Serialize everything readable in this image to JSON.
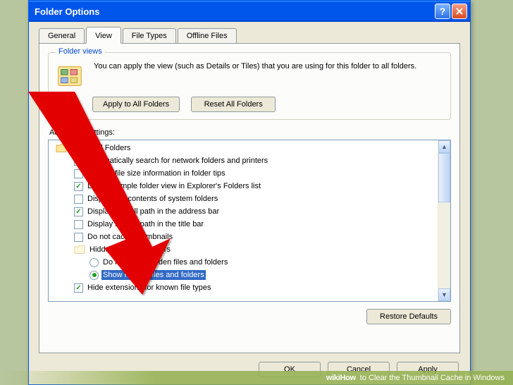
{
  "titlebar": {
    "title": "Folder Options"
  },
  "tabs": {
    "general": "General",
    "view": "View",
    "file_types": "File Types",
    "offline_files": "Offline Files"
  },
  "folder_views": {
    "legend": "Folder views",
    "text": "You can apply the view (such as Details or Tiles) that you are using for this folder to all folders.",
    "apply_all": "Apply to All Folders",
    "reset_all": "Reset All Folders"
  },
  "advanced": {
    "label": "Advanced settings:",
    "root": "Files and Folders",
    "items": [
      {
        "kind": "checkbox",
        "checked": true,
        "indent": 1,
        "label": "Automatically search for network folders and printers"
      },
      {
        "kind": "checkbox",
        "checked": false,
        "indent": 1,
        "label": "Display file size information in folder tips"
      },
      {
        "kind": "checkbox",
        "checked": true,
        "indent": 1,
        "label": "Display simple folder view in Explorer's Folders list"
      },
      {
        "kind": "checkbox",
        "checked": false,
        "indent": 1,
        "label": "Display the contents of system folders"
      },
      {
        "kind": "checkbox",
        "checked": true,
        "indent": 1,
        "label": "Display the full path in the address bar"
      },
      {
        "kind": "checkbox",
        "checked": false,
        "indent": 1,
        "label": "Display the full path in the title bar"
      },
      {
        "kind": "checkbox",
        "checked": false,
        "indent": 1,
        "label": "Do not cache thumbnails"
      },
      {
        "kind": "group",
        "indent": 1,
        "label": "Hidden files and folders"
      },
      {
        "kind": "radio",
        "checked": false,
        "indent": 2,
        "label": "Do not show hidden files and folders"
      },
      {
        "kind": "radio",
        "checked": true,
        "indent": 2,
        "selected": true,
        "label": "Show hidden files and folders"
      },
      {
        "kind": "checkbox",
        "checked": true,
        "indent": 1,
        "label": "Hide extensions for known file types"
      }
    ],
    "restore": "Restore Defaults"
  },
  "buttons": {
    "ok": "OK",
    "cancel": "Cancel",
    "apply": "Apply"
  },
  "watermark": {
    "logo": "wikiHow",
    "suffix": "to Clear the Thumbnail Cache in Windows"
  }
}
